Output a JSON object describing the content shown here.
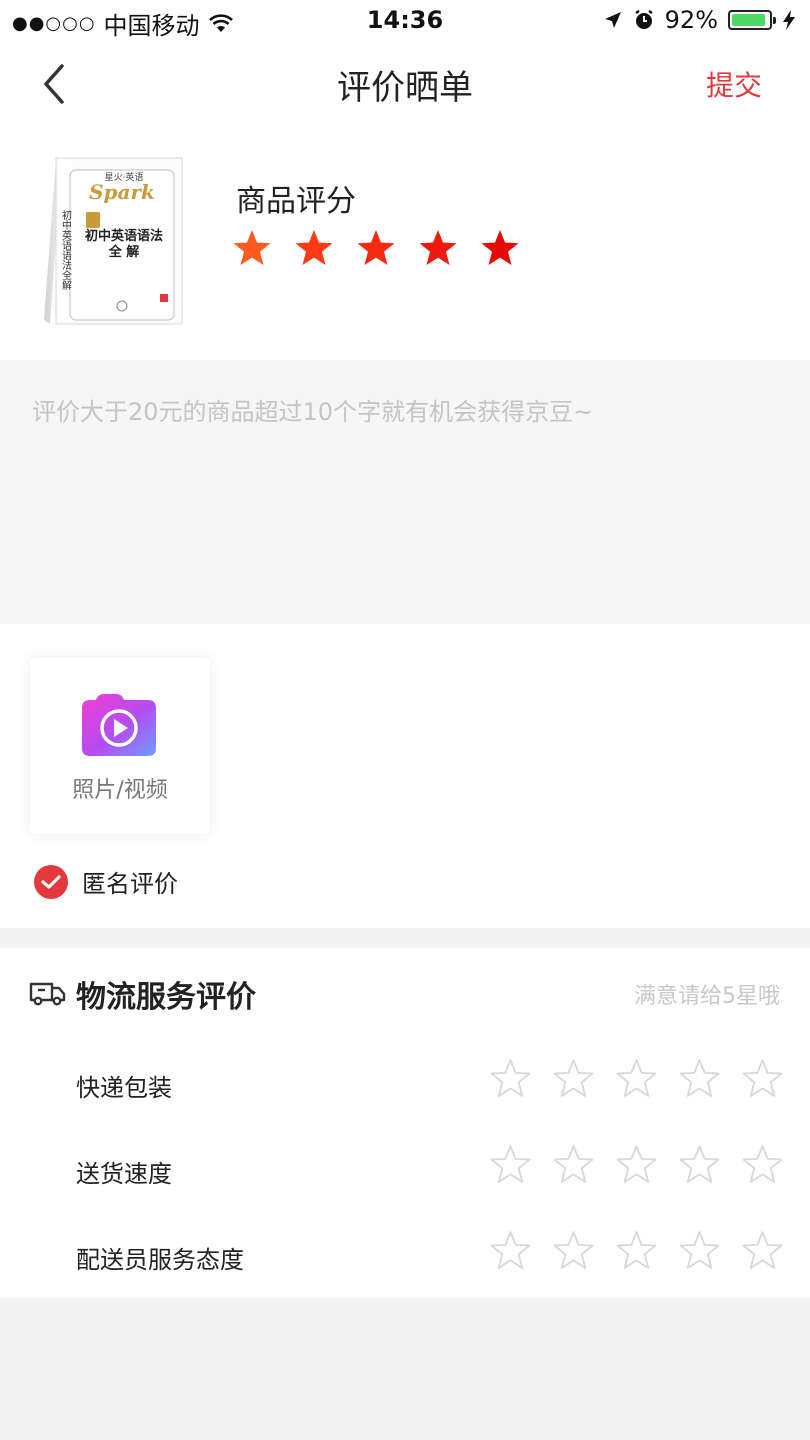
{
  "status_bar": {
    "signal": "●●○○○",
    "carrier": "中国移动",
    "time": "14:36",
    "battery": "92%",
    "battery_level": 0.92
  },
  "navbar": {
    "title": "评价晒单",
    "submit_label": "提交",
    "back_icon": "chevron-left-icon"
  },
  "product": {
    "rating_label": "商品评分",
    "rating": 5,
    "rating_max": 5,
    "cover": {
      "brand_top": "星火·英语",
      "brand": "Spark",
      "title_line1": "初中英语语法",
      "title_line2": "全 解",
      "spine": "初中英语语法全解"
    }
  },
  "review": {
    "placeholder": "评价大于20元的商品超过10个字就有机会获得京豆~"
  },
  "upload": {
    "label": "照片/视频",
    "icon": "camera-video-icon"
  },
  "anonymous": {
    "label": "匿名评价",
    "checked": true
  },
  "logistics": {
    "title": "物流服务评价",
    "hint": "满意请给5星哦",
    "icon": "truck-icon",
    "rows": [
      {
        "label": "快递包装",
        "rating": 0
      },
      {
        "label": "送货速度",
        "rating": 0
      },
      {
        "label": "配送员服务态度",
        "rating": 0
      }
    ]
  },
  "colors": {
    "accent": "#e4393c",
    "star_gradient": [
      "#ff5a1f",
      "#ff3a14",
      "#f52a10",
      "#ee1a0c",
      "#e80808"
    ],
    "star_empty": "#d8d8d8"
  }
}
